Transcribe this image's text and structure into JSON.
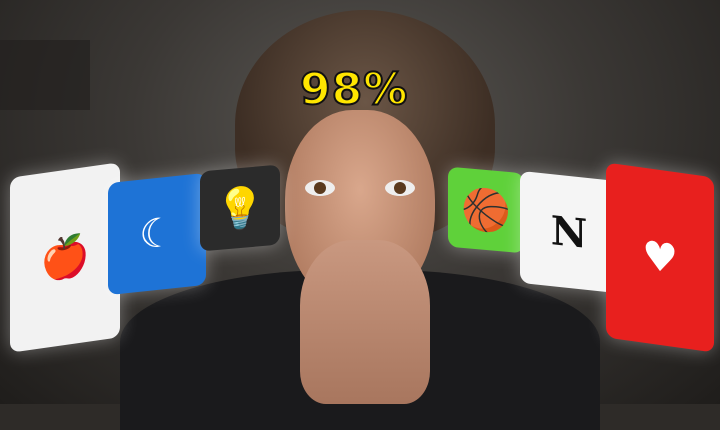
{
  "overlay_text": "98%",
  "colors": {
    "overlay_text": "#ffe600"
  },
  "app_icons": [
    {
      "name": "food-icon",
      "color": "#f2f2f2"
    },
    {
      "name": "sleep-moon-icon",
      "color": "#1e73d6"
    },
    {
      "name": "lightbulb-icon",
      "color": "#2b2b2b"
    },
    {
      "name": "sports-balls-icon",
      "color": "#5fd13a"
    },
    {
      "name": "notion-icon",
      "color": "#f5f5f5"
    },
    {
      "name": "heart-icon",
      "color": "#e8201e"
    }
  ]
}
